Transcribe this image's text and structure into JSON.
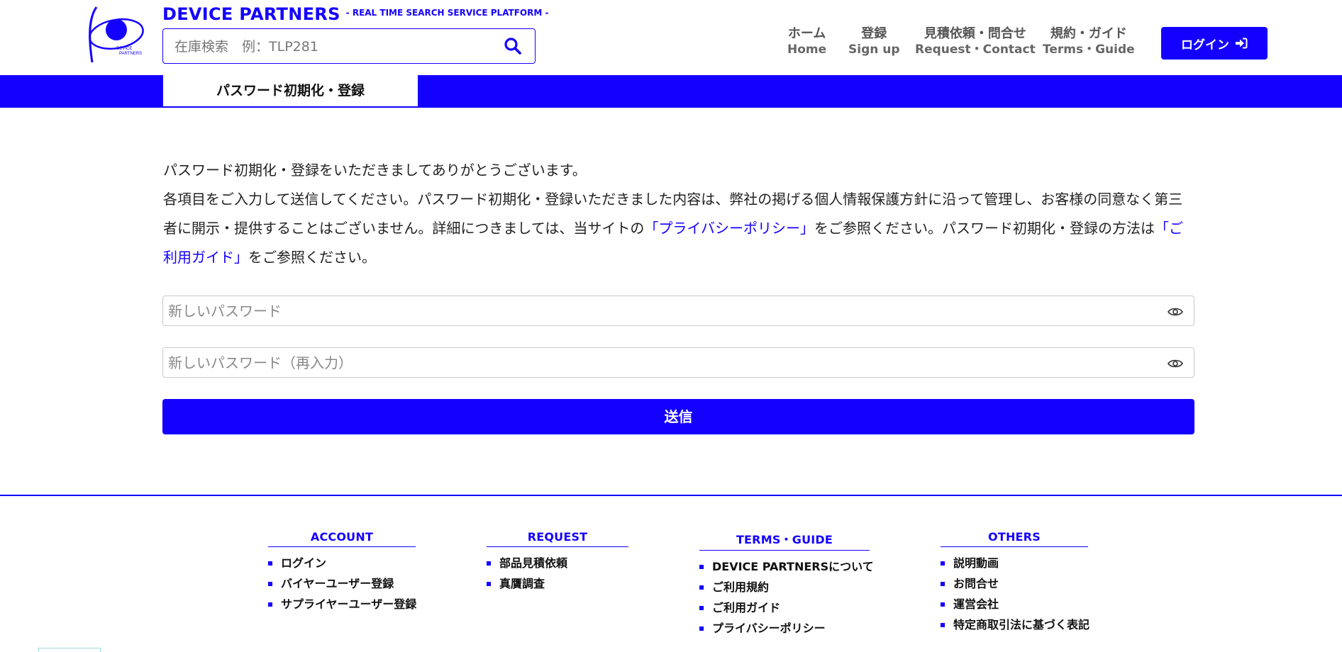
{
  "header": {
    "brand": "DEVICE PARTNERS",
    "tagline": "- REAL TIME SEARCH SERVICE PLATFORM -",
    "logo_text_1": "DEVICE",
    "logo_text_2": "PARTNERS",
    "search": {
      "placeholder": "在庫検索　例：TLP281",
      "value": "",
      "icon": "search-icon"
    },
    "nav": [
      {
        "jp": "ホーム",
        "en": "Home"
      },
      {
        "jp": "登録",
        "en": "Sign up"
      },
      {
        "jp": "見積依頼・問合せ",
        "en": "Request・Contact"
      },
      {
        "jp": "規約・ガイド",
        "en": "Terms・Guide"
      }
    ],
    "login_label": "ログイン",
    "login_icon": "sign-in-icon"
  },
  "page": {
    "tab_title": "パスワード初期化・登録",
    "intro_line1": "パスワード初期化・登録をいただきましてありがとうございます。",
    "intro_text_a": "各項目をご入力して送信してください。パスワード初期化・登録いただきました内容は、弊社の掲げる個人情報保護方針に沿って管理し、お客様の同意なく第三者に開示・提供することはございません。詳細につきましては、当サイトの",
    "privacy_link": "「プライバシーポリシー」",
    "intro_text_b": "をご参照ください。パスワード初期化・登録の方法は",
    "guide_link": "「ご利用ガイド」",
    "intro_text_c": "をご参照ください。",
    "password_field": {
      "placeholder": "新しいパスワード",
      "value": ""
    },
    "password_confirm_field": {
      "placeholder": "新しいパスワード（再入力）",
      "value": ""
    },
    "eye_icon": "eye-icon",
    "submit_label": "送信"
  },
  "footer": {
    "columns": [
      {
        "title": "ACCOUNT",
        "items": [
          "ログイン",
          "バイヤーユーザー登録",
          "サプライヤーユーザー登録"
        ]
      },
      {
        "title": "REQUEST",
        "items": [
          "部品見積依頼",
          "真贋調査"
        ]
      },
      {
        "title": "TERMS・GUIDE",
        "items": [
          "DEVICE PARTNERSについて",
          "ご利用規約",
          "ご利用ガイド",
          "プライバシーポリシー"
        ]
      },
      {
        "title": "OTHERS",
        "items": [
          "説明動画",
          "お問合せ",
          "運営会社",
          "特定商取引法に基づく表記"
        ]
      }
    ]
  },
  "colors": {
    "accent": "#1400ff",
    "text": "#222222",
    "border": "#c9c9c9"
  }
}
